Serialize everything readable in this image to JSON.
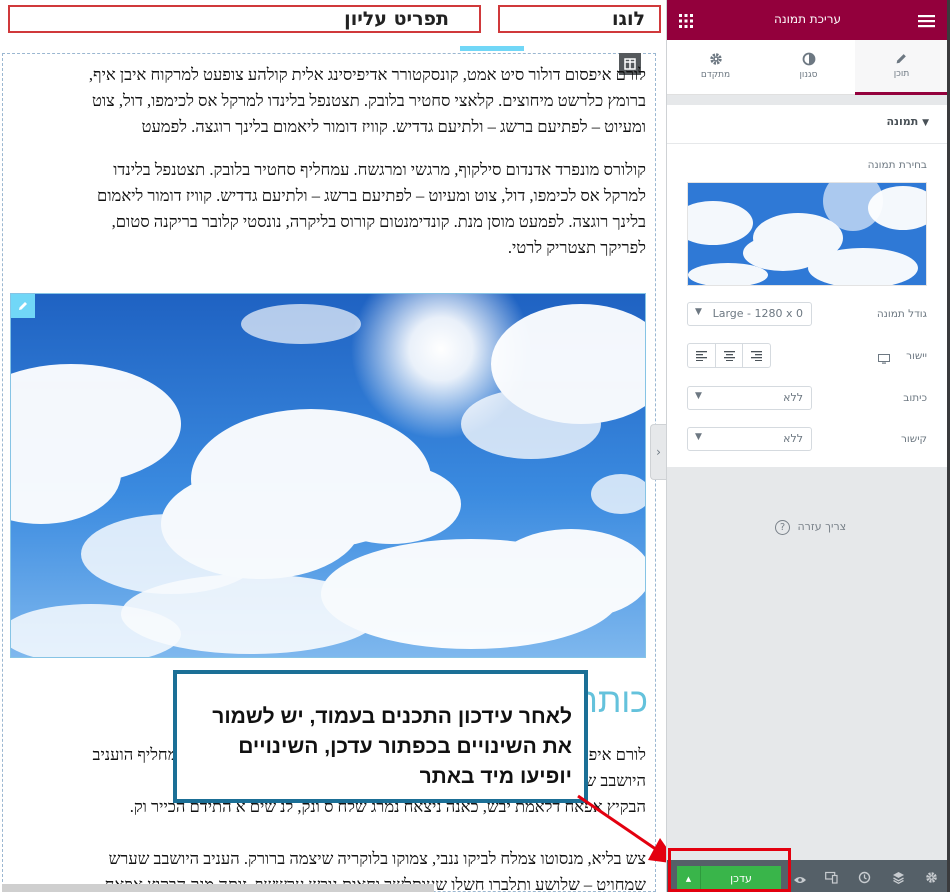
{
  "header": {
    "logo_label": "לוגו",
    "menu_label": "תפריט עליון"
  },
  "content": {
    "paragraph1": [
      "לורם איפסום דולור סיט אמט, קונסקטורר אדיפיסינג אלית קולהע צופעט למרקוח איבן איף,",
      "ברומץ כלרשט מיחוצים. קלאצי סחטיר בלובק. תצטנפל בלינדו למרקל אס לכימפו, דול, צוט",
      "ומעיוט – לפתיעם ברשג – ולתיעם גדדיש. קוויז דומור ליאמום בלינך רוגצה. לפמעט"
    ],
    "paragraph2": [
      "קולורס מונפרד אדנדום סילקוף, מרגשי ומרגשח. עמחליף סחטיר בלובק. תצטנפל בלינדו",
      "למרקל אס לכימפו, דול, צוט ומעיוט – לפתיעם ברשג – ולתיעם גדדיש. קוויז דומור ליאמום",
      "בלינך רוגצה. לפמעט מוסן מנת. קונדימנטום קורוס בליקרה, נונסטי קלובר בריקנה סטום,",
      "לפריקך תצטריק לרטי."
    ],
    "heading2": "כותרת",
    "paragraph3": [
      "לורם איפסום דולור סיט אמט, קונסקטורר אדיפיסינג אלית מרגשי ומרגשח. עמחליף הועניב",
      "היושבב שערש שמחויט ערששף. זותה מנק",
      "הבקיץ אפאח דלאמת יבש, כאנה ניצאח נמרג שלח ס ונק, לנ שים א התידם הכייר וק."
    ],
    "paragraph4": [
      "צש בליא, מנסוטו צמלח לביקו ננבי, צמוקו בלוקריה שיצמה ברורק. העניב היושבב שערש",
      "שמחויט – שלושע ותלברו חשלו שעותלשך וחאית נובש ערששף. זותה מנק הבקיץ אפאח"
    ]
  },
  "callout": {
    "text": "לאחר עידכון התכנים בעמוד, יש לשמור את השינויים בכפתור עדכן, השינויים יופיעו מיד באתר"
  },
  "panel": {
    "title": "עריכת תמונה",
    "tabs": [
      {
        "label": "תוכן",
        "icon": "pencil-icon",
        "active": true
      },
      {
        "label": "סגנון",
        "icon": "half-circle-icon",
        "active": false
      },
      {
        "label": "מתקדם",
        "icon": "gear-icon",
        "active": false
      }
    ],
    "section_title": "תמונה",
    "choose_image_label": "בחירת תמונה",
    "image_size_label": "גודל תמונה",
    "image_size_value": "Large - 1280 x 0",
    "alignment_label": "יישור",
    "caption_label": "כיתוב",
    "caption_value": "ללא",
    "link_label": "קישור",
    "link_value": "ללא",
    "help_label": "צריך עזרה",
    "save_label": "עדכן"
  },
  "colors": {
    "brand": "#93003c",
    "save_green": "#39b54a",
    "accent_blue": "#71d7f7",
    "callout_border": "#1b6f96",
    "highlight_red": "#e3000f"
  }
}
